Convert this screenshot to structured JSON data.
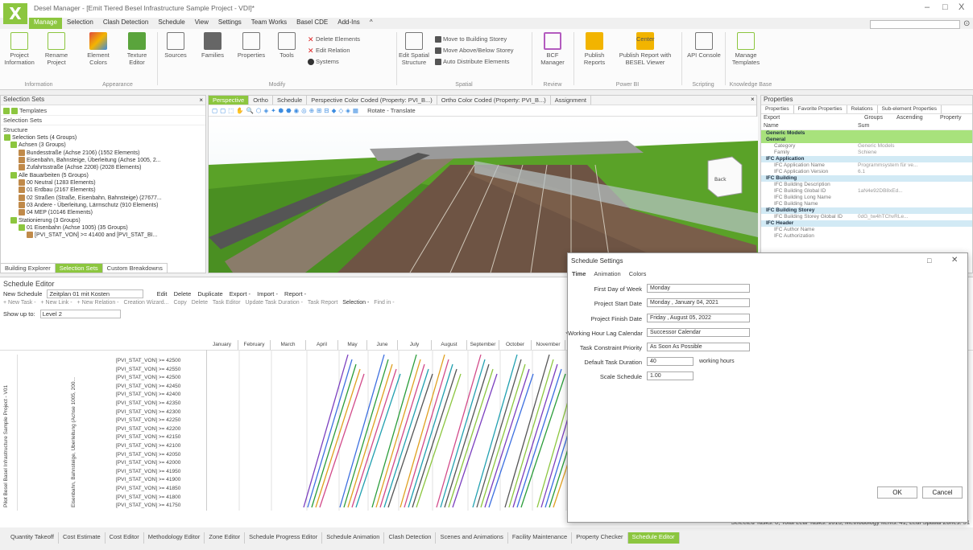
{
  "app": {
    "logo": "X",
    "title": "Desel Manager - [Emit Tiered Besel Infrastructure Sample Project - VDI]*",
    "minimize": "–",
    "maximize": "□",
    "close": "X"
  },
  "menu": [
    "Manage",
    "Selection",
    "Clash Detection",
    "Schedule",
    "View",
    "Settings",
    "Team Works",
    "Basel CDE",
    "Add-Ins",
    "^"
  ],
  "ribbon": {
    "buttons": [
      {
        "label": "Project Information"
      },
      {
        "label": "Rename Project"
      },
      {
        "label": "Element Colors"
      },
      {
        "label": "Texture Editor"
      },
      {
        "label": "Sources"
      },
      {
        "label": "Families"
      },
      {
        "label": "Properties"
      },
      {
        "label": "Tools"
      },
      {
        "label": "Edit Spatial Structure"
      },
      {
        "label": "BCF Manager"
      },
      {
        "label": "Publish Reports"
      },
      {
        "label": "Publish Report with BESEL Viewer"
      },
      {
        "label": "API Console"
      },
      {
        "label": "Manage Templates"
      }
    ],
    "small": [
      "Delete Elements",
      "Edit Relation",
      "Systems",
      "Move to Building Storey",
      "Move Above/Below Storey",
      "Auto Distribute Elements",
      "Center"
    ],
    "groups": [
      "Information",
      "Appearance",
      "Modify",
      "Spatial",
      "Review",
      "Power BI",
      "Scripting",
      "Knowledge Base"
    ]
  },
  "selection_sets": {
    "title": "Selection Sets",
    "toolbar": "Templates",
    "tab": "Selection Sets",
    "structure": "Structure",
    "tree": [
      "Selection Sets (4 Groups)",
      "Achsen (3 Groups)",
      "Bundesstraße (Achse 2106) (1552 Elements)",
      "Eisenbahn, Bahnsteige, Überleitung (Achse 1005, 2...",
      "Zufahrtsstraße (Achse 2208) (2028 Elements)",
      "Alle Bauarbeiten (5 Groups)",
      "00 Neutral (1283 Elements)",
      "01 Erdbau (2167 Elements)",
      "02 Straßen (Straße, Eisenbahn, Bahnsteige) (27677...",
      "03 Andere - Überleitung, Lärmschutz (910 Elements)",
      "04 MEP (10146 Elements)",
      "Stationierung (3 Groups)",
      "01 Eisenbahn (Achse 1005) (35 Groups)",
      "[PVI_STAT_VON] >= 41400 and [PVI_STAT_BI..."
    ],
    "bottom_tabs": [
      "Building Explorer",
      "Selection Sets",
      "Custom Breakdowns"
    ]
  },
  "viewport": {
    "tabs": [
      "Perspective",
      "Ortho",
      "Schedule",
      "Perspective Color Coded (Property: PVI_B...)",
      "Ortho Color Coded (Property: PVI_B...)",
      "Assignment"
    ],
    "tools": "Rotate - Translate",
    "viewcube": "Back"
  },
  "properties": {
    "title": "Properties",
    "tabs": [
      "Properties",
      "Favorite Properties",
      "Relations",
      "Sub-element Properties"
    ],
    "export": "Export",
    "groups": "Groups",
    "ascending": "Ascending",
    "property": "Property",
    "col_name": "Name",
    "col_sum": "Sum",
    "rows": [
      {
        "cat": "Generic Models",
        "g": true
      },
      {
        "cat": "General",
        "g": true
      },
      {
        "n": "Category",
        "v": "Generic Models"
      },
      {
        "n": "Family",
        "v": "Schiene"
      },
      {
        "cat": "IFC Application"
      },
      {
        "n": "IFC Application Name",
        "v": "Programmsystem für ve..."
      },
      {
        "n": "IFC Application Version",
        "v": "6.1"
      },
      {
        "cat": "IFC Building"
      },
      {
        "n": "IFC Building Description",
        "v": ""
      },
      {
        "n": "IFC Building Global ID",
        "v": "1aN4e92DB8xEd..."
      },
      {
        "n": "IFC Building Long Name",
        "v": ""
      },
      {
        "n": "IFC Building Name",
        "v": ""
      },
      {
        "cat": "IFC Building Storey"
      },
      {
        "n": "IFC Building Storey Global ID",
        "v": "0dG_tw4hTChvRLe..."
      },
      {
        "cat": "IFC Header"
      },
      {
        "n": "IFC Author Name",
        "v": ""
      },
      {
        "n": "IFC Authorization",
        "v": ""
      }
    ]
  },
  "schedule": {
    "title": "Schedule Editor",
    "toolbar1": [
      "New Schedule",
      "Zeitplan 01 mit Kosten",
      "Edit",
      "Delete",
      "Duplicate",
      "Export -",
      "Import -",
      "Report -"
    ],
    "toolbar2": [
      "+ New Task -",
      "+ New Link -",
      "+ New Relation -",
      "Creation Wizard...",
      "Copy",
      "Delete",
      "Task Editor",
      "Update Task Duration -",
      "Task Report",
      "Selection -",
      "Find in -"
    ],
    "show_up_to": "Show up to:",
    "level": "Level 2",
    "year": "Year: 2021",
    "months": [
      "January",
      "February",
      "March",
      "April",
      "May",
      "June",
      "July",
      "August",
      "September",
      "October",
      "November"
    ],
    "side1": "Pilot Besel Basel Infrastructure Sample Project - V01",
    "side2": "Eisenbahn, Bahnsteige, Überleitung (Achse 1005, 200...",
    "rows": [
      "[PVI_STAT_VON] >= 42500",
      "[PVI_STAT_VON] >= 42550",
      "[PVI_STAT_VON] >= 42500",
      "[PVI_STAT_VON] >= 42450",
      "[PVI_STAT_VON] >= 42400",
      "[PVI_STAT_VON] >= 42350",
      "[PVI_STAT_VON] >= 42300",
      "[PVI_STAT_VON] >= 42250",
      "[PVI_STAT_VON] >= 42200",
      "[PVI_STAT_VON] >= 42150",
      "[PVI_STAT_VON] >= 42100",
      "[PVI_STAT_VON] >= 42050",
      "[PVI_STAT_VON] >= 42000",
      "[PVI_STAT_VON] >= 41950",
      "[PVI_STAT_VON] >= 41900",
      "[PVI_STAT_VON] >= 41850",
      "[PVI_STAT_VON] >= 41800",
      "[PVI_STAT_VON] >= 41750"
    ]
  },
  "status": "Selected Tasks: 0, Total Leaf Tasks: 1013, Methodology Items: 41, Leaf Spatial Zones: 51",
  "bottom_tabs": [
    "Quantity Takeoff",
    "Cost Estimate",
    "Cost Editor",
    "Methodology Editor",
    "Zone Editor",
    "Schedule Progress Editor",
    "Schedule Animation",
    "Clash Detection",
    "Scenes and Animations",
    "Facility Maintenance",
    "Property Checker",
    "Schedule Editor"
  ],
  "dialog": {
    "title": "Schedule Settings",
    "tabs": [
      "Time",
      "Animation",
      "Colors"
    ],
    "fields": [
      {
        "label": "First Day of Week",
        "value": "Monday"
      },
      {
        "label": "Project Start Date",
        "value": "Monday , January 04, 2021"
      },
      {
        "label": "Project Finish Date",
        "value": "Friday , August 05, 2022"
      },
      {
        "label": "Working Hour Lag Calendar",
        "value": "Successor Calendar"
      },
      {
        "label": "Task Constraint Priority",
        "value": "As Soon As Possible"
      },
      {
        "label": "Default Task Duration",
        "value": "40"
      },
      {
        "label": "Scale Schedule",
        "value": "1.00"
      }
    ],
    "unit": "working hours",
    "ok": "OK",
    "cancel": "Cancel"
  }
}
